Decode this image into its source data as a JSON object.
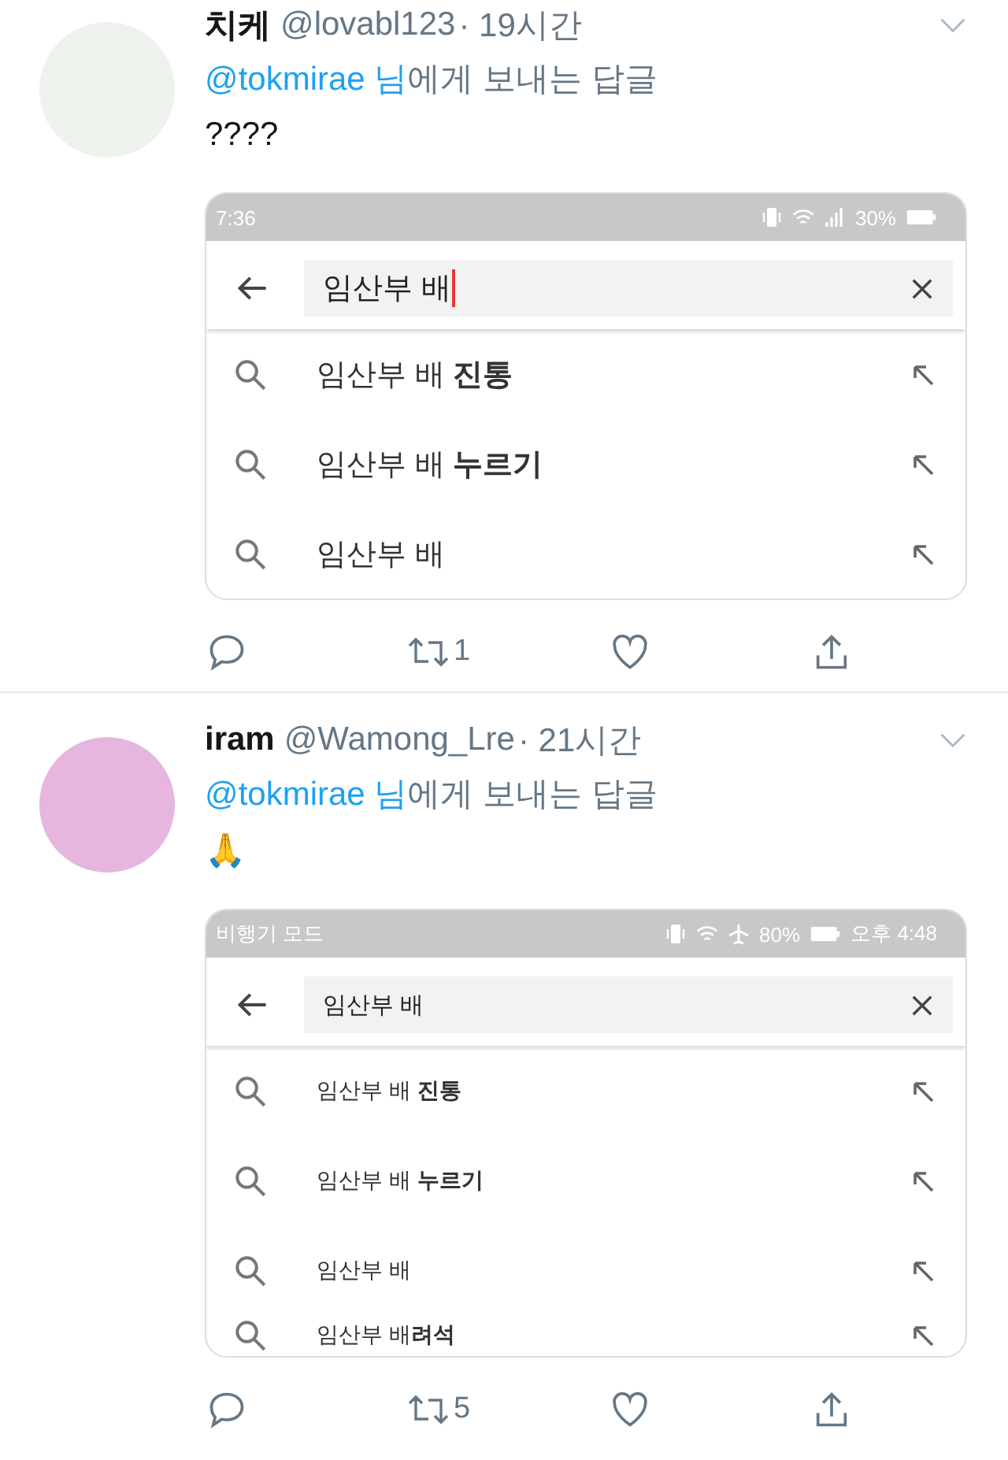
{
  "tweets": [
    {
      "name": "치케",
      "handle": "@lovabl123",
      "time": "· 19시간",
      "reply_to": "@tokmirae 님",
      "reply_suffix": "에게 보내는 답글",
      "body": "????",
      "screenshot": {
        "status_left": "7:36",
        "status_items": [
          {
            "kind": "vibrate"
          },
          {
            "kind": "wifi"
          },
          {
            "kind": "signal"
          },
          {
            "kind": "text",
            "text": "30%"
          },
          {
            "kind": "battery"
          }
        ],
        "query": "임산부 배",
        "cursor": true,
        "suggestions": [
          "임산부 배 **진통**",
          "임산부 배 **누르기**",
          "임산부 배"
        ]
      },
      "actions": [
        {
          "kind": "reply"
        },
        {
          "kind": "retweet",
          "count": "1"
        },
        {
          "kind": "like"
        },
        {
          "kind": "share"
        }
      ]
    },
    {
      "name": "iram",
      "handle": "@Wamong_Lre",
      "time": "· 21시간",
      "reply_to": "@tokmirae 님",
      "reply_suffix": "에게 보내는 답글",
      "body": "🙏",
      "screenshot": {
        "status_left": "비행기 모드",
        "status_items": [
          {
            "kind": "vibrate"
          },
          {
            "kind": "wifi"
          },
          {
            "kind": "airplane"
          },
          {
            "kind": "text",
            "text": "80%"
          },
          {
            "kind": "battery"
          },
          {
            "kind": "text",
            "text": "오후 4:48"
          }
        ],
        "query": "임산부 배",
        "cursor": false,
        "suggestions": [
          "임산부 배 **진통**",
          "임산부 배 **누르기**",
          "임산부 배",
          "임산부 배**려석**"
        ]
      },
      "actions": [
        {
          "kind": "reply"
        },
        {
          "kind": "retweet",
          "count": "5"
        },
        {
          "kind": "like"
        },
        {
          "kind": "share"
        }
      ]
    }
  ]
}
